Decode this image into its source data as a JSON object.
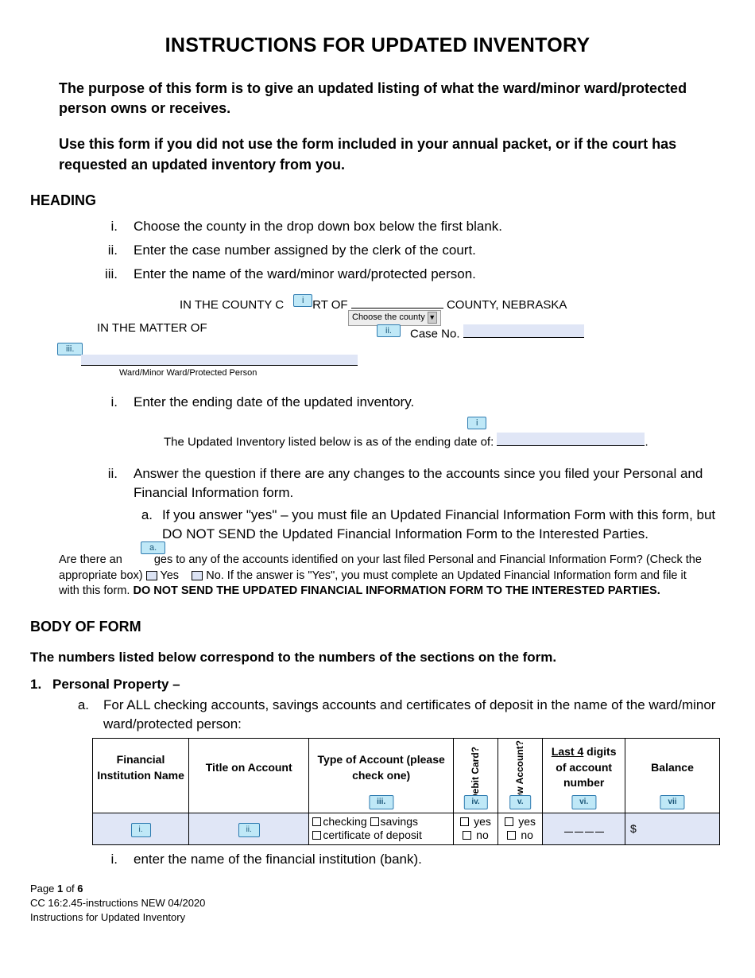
{
  "title": "INSTRUCTIONS FOR UPDATED INVENTORY",
  "intro": {
    "p1": "The purpose of this form is to give an updated listing of what the ward/minor ward/protected person owns or receives.",
    "p2": "Use this form if you did not use the form included in your annual packet, or if the court has requested an updated inventory from you."
  },
  "heading_section": {
    "title": "HEADING",
    "items": [
      {
        "num": "i.",
        "text": "Choose the county in the drop down box below the first blank."
      },
      {
        "num": "ii.",
        "text": "Enter the case number assigned by the clerk of the court."
      },
      {
        "num": "iii.",
        "text": "Enter the name of the ward/minor ward/protected person."
      }
    ]
  },
  "diagram1": {
    "line1a": "IN THE  COUNTY  C",
    "line1b": "RT OF",
    "line1c": "COUNTY, NEBRASKA",
    "marker_i": "i",
    "marker_ii": "ii.",
    "marker_iii": "iii.",
    "dropdown": "Choose the county",
    "matter": "IN THE MATTER OF",
    "case": "Case No.",
    "ward_label": "Ward/Minor Ward/Protected Person"
  },
  "mid_items": [
    {
      "num": "i.",
      "text": "Enter the ending date of the updated inventory."
    }
  ],
  "diagram2": {
    "marker_i": "i",
    "text": "The Updated Inventory listed below is as of the ending date of:"
  },
  "mid_items2": {
    "num": "ii.",
    "text": "Answer the question if there are any changes to the accounts since you filed your Personal and Financial Information form.",
    "sub_num": "a.",
    "sub_text": "If you answer \"yes\" – you must file an Updated Financial Information Form with this form, but DO NOT SEND the Updated Financial Information Form to the Interested Parties."
  },
  "changes": {
    "marker_a": "a.",
    "line1a": "Are there an",
    "line1b": "ges to any of the accounts identified on your last filed Personal and Financial Information Form? (Check the",
    "line2a": "appropriate box)",
    "yes": "Yes",
    "no": "No.  If the answer is \"Yes\", you must complete an Updated Financial Information form and file it",
    "line3a": "with this form.  ",
    "line3b": "DO NOT SEND THE UPDATED FINANCIAL INFORMATION FORM TO THE INTERESTED PARTIES."
  },
  "body_section": {
    "title": "BODY OF FORM",
    "lead": "The numbers listed below correspond to the numbers of the sections on the form.",
    "item1_num": "1.",
    "item1_title": "Personal Property –",
    "item1a_num": "a.",
    "item1a_text": "For ALL checking accounts, savings accounts and certificates of deposit in the name of the ward/minor ward/protected person:"
  },
  "table": {
    "headers": {
      "h1": "Financial Institution Name",
      "h2": "Title on Account",
      "h3": "Type of Account (please check one)",
      "h4": "Debit Card?",
      "h5": "New Account?",
      "h6a": "Last 4",
      "h6b": " digits of account number",
      "h7": "Balance"
    },
    "markers": {
      "m1": "i.",
      "m2": "ii.",
      "m3": "iii.",
      "m4": "iv.",
      "m5": "v.",
      "m6": "vi.",
      "m7": "vii"
    },
    "row": {
      "checking": "checking",
      "savings": "savings",
      "cod": "certificate of deposit",
      "yes": "yes",
      "no": "no",
      "dollar": "$"
    }
  },
  "below_table": {
    "num": "i.",
    "text": "enter the name of the financial institution (bank)."
  },
  "footer": {
    "l1a": "Page ",
    "l1b": "1",
    "l1c": " of ",
    "l1d": "6",
    "l2": "CC 16:2.45-instructions NEW 04/2020",
    "l3": "Instructions for Updated Inventory"
  }
}
